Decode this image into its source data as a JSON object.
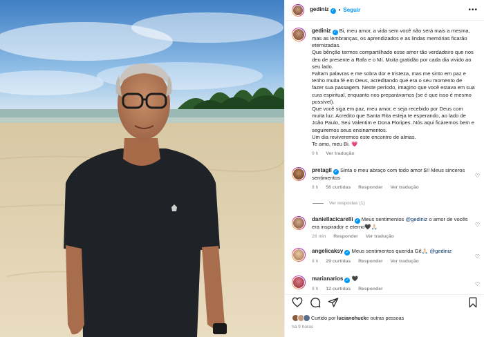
{
  "header": {
    "username": "gediniz",
    "verified_mark": "✓",
    "separator": "•",
    "follow_label": "Seguir",
    "more_icon": "more-horizontal-icon"
  },
  "caption": {
    "username": "gediniz",
    "lines": [
      "Bi, meu amor, a vida sem você não será mais a mesma, mas as lembranças, os aprendizados e as lindas memórias ficarão eternizadas.",
      "Que bênção termos compartilhado esse amor tão verdadeiro que nos deu de presente a Rafa e o Mi. Muita gratidão por cada dia vivido ao seu lado.",
      "Faltam palavras e me sobra dor e tristeza, mas me sinto em paz e tenho muita fé em Deus, acreditando que era o seu momento de fazer sua passagem. Neste período, imagino que você estava em sua cura espiritual, enquanto nos preparávamos (se é que isso é mesmo possível).",
      "Que você siga em paz, meu amor, e seja recebido por Deus com muita luz. Acredito que Santa Rita esteja te esperando, ao lado de João Paulo, Seu Valentim e Dona Floripes. Nós aqui ficaremos bem e seguiremos seus ensinamentos.",
      "Um dia reviveremos este encontro de almas.",
      "Te amo, meu Bi. 💗"
    ],
    "time": "9 h",
    "translate_label": "Ver tradução"
  },
  "comments": [
    {
      "username": "pretagil",
      "text": "Sinta o meu abraço com todo amor $!! Meus sinceros sentimentos",
      "time": "8 h",
      "likes": "56 curtidas",
      "reply_label": "Responder",
      "translate_label": "Ver tradução",
      "avatar_color": "#8a5a3c",
      "replies_label": "Ver respostas (1)"
    },
    {
      "username": "daniellacicarelli",
      "text_before": "Meus sentimentos ",
      "mention": "@gediniz",
      "text_after": " o amor de vocês era inspirador e eterno🖤🙏🏻",
      "time": "28 min",
      "reply_label": "Responder",
      "translate_label": "Ver tradução",
      "avatar_color": "#b38a6a"
    },
    {
      "username": "angelicaksy",
      "text_before": "Meus sentimentos querida Gê🙏🏻 ",
      "mention": "@gediniz",
      "time": "8 h",
      "likes": "29 curtidas",
      "reply_label": "Responder",
      "translate_label": "Ver tradução",
      "avatar_color": "#d9b38c"
    },
    {
      "username": "marianarios",
      "text": "🖤",
      "time": "8 h",
      "likes": "12 curtidas",
      "reply_label": "Responder",
      "avatar_color": "#c44a5a"
    }
  ],
  "actions": {
    "like_icon": "heart-icon",
    "comment_icon": "comment-icon",
    "share_icon": "send-icon",
    "save_icon": "bookmark-icon"
  },
  "liked_by": {
    "prefix": "Curtido por ",
    "user": "lucianohuck",
    "suffix": " e outras pessoas"
  },
  "time_ago": "há 9 horas",
  "colors": {
    "accent": "#0095f6",
    "muted": "#8e8e8e",
    "text": "#262626"
  }
}
